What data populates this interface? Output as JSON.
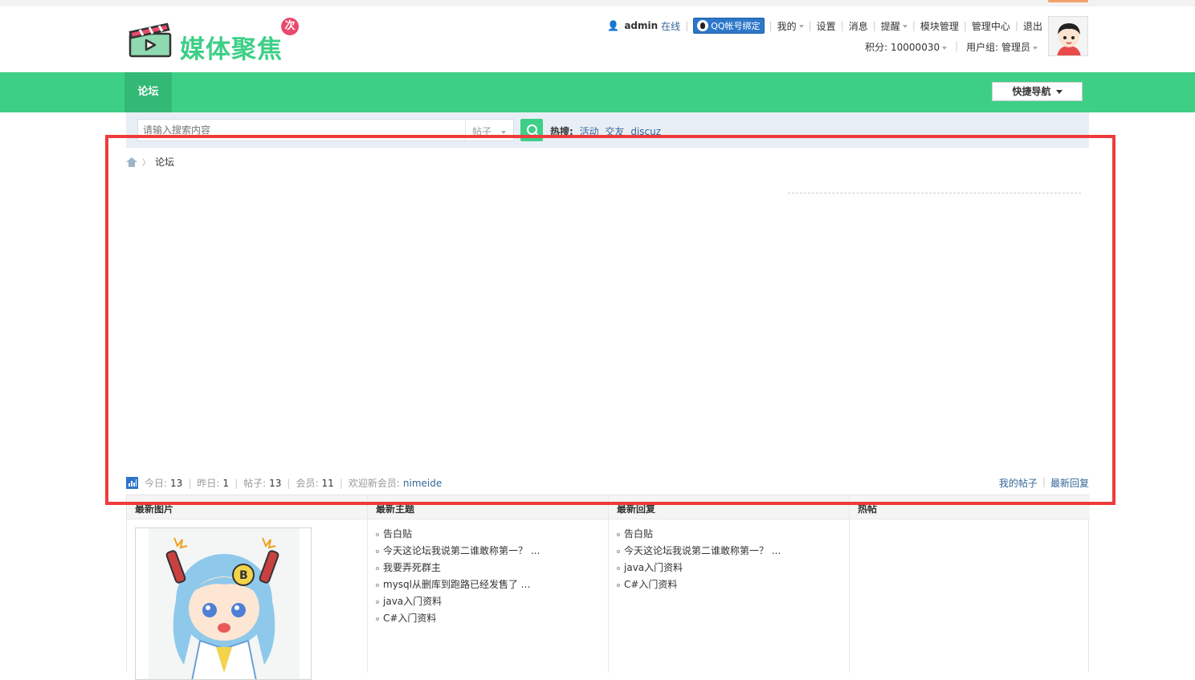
{
  "brand": {
    "name": "媒体聚焦",
    "badge": "次"
  },
  "userbar": {
    "username": "admin",
    "status": "在线",
    "qq_bind": "QQ帐号绑定",
    "links": [
      "我的",
      "设置",
      "消息",
      "提醒",
      "模块管理",
      "管理中心",
      "退出"
    ],
    "credits": "积分: 10000030",
    "group": "用户组: 管理员"
  },
  "nav": {
    "tab": "论坛",
    "quick_nav": "快捷导航"
  },
  "search": {
    "placeholder": "请输入搜索内容",
    "type": "帖子",
    "hot_label": "热搜:",
    "hot_terms": [
      "活动",
      "交友",
      "discuz"
    ]
  },
  "breadcrumb": {
    "current": "论坛"
  },
  "stats": {
    "today_label": "今日:",
    "today": "13",
    "yesterday_label": "昨日:",
    "yesterday": "1",
    "posts_label": "帖子:",
    "posts": "13",
    "members_label": "会员:",
    "members": "11",
    "newest_label": "欢迎新会员:",
    "newest": "nimeide",
    "my_posts": "我的帖子",
    "latest_replies": "最新回复"
  },
  "panels": {
    "pics": {
      "title": "最新图片"
    },
    "topics": {
      "title": "最新主题",
      "items": [
        "告白贴",
        "今天这论坛我说第二谁敢称第一？ ...",
        "我要弄死群主",
        "mysql从删库到跑路已经发售了 ...",
        "java入门资料",
        "C#入门资料"
      ]
    },
    "replies": {
      "title": "最新回复",
      "items": [
        "告白贴",
        "今天这论坛我说第二谁敢称第一？ ...",
        "java入门资料",
        "C#入门资料"
      ]
    },
    "hot": {
      "title": "热帖"
    }
  },
  "colors": {
    "accent": "#3ecf86",
    "accent_dark": "#33b876",
    "link": "#336699",
    "highlight": "#ef3b3b"
  }
}
